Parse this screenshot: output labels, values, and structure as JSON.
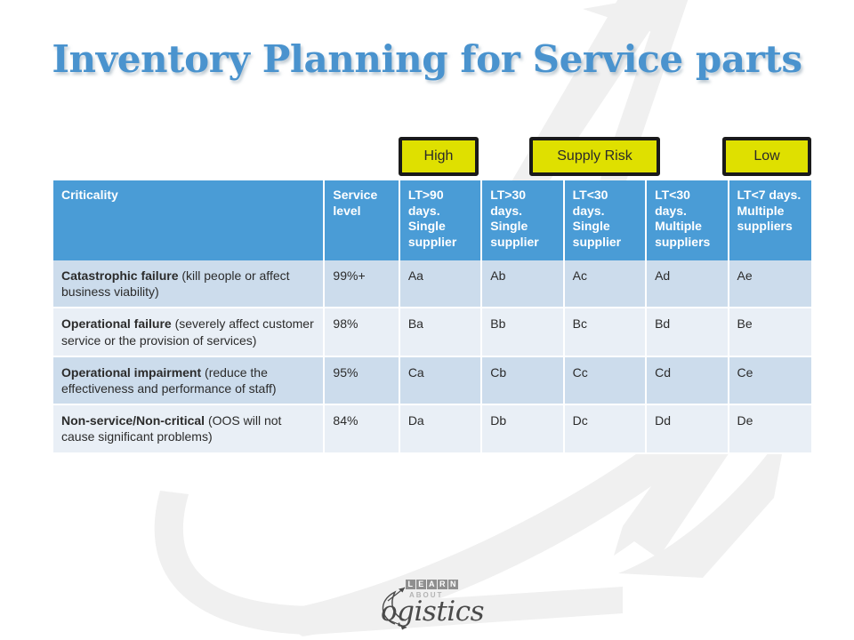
{
  "slide": {
    "title": "Inventory Planning for Service parts",
    "title_color": "#4a93ce",
    "background_color": "#ffffff"
  },
  "legend": {
    "label": "Supply Risk",
    "high": "High",
    "low": "Low",
    "box_fill": "#dfe000",
    "box_border": "#1a1a1a"
  },
  "table": {
    "header_color": "#4a9cd6",
    "row_shade_color": "#ccdcec",
    "row_plain_color": "#e9eff6",
    "columns": [
      "Criticality",
      "Service level",
      "LT>90 days. Single supplier",
      "LT>30 days. Single supplier",
      "LT<30 days. Single supplier",
      "LT<30 days. Multiple suppliers",
      "LT<7 days. Multiple suppliers"
    ],
    "rows": [
      {
        "criticality_name": "Catastrophic failure",
        "criticality_desc": " (kill people or affect business viability)",
        "service_level": "99%+",
        "codes": [
          "Aa",
          "Ab",
          "Ac",
          "Ad",
          "Ae"
        ]
      },
      {
        "criticality_name": "Operational failure",
        "criticality_desc": " (severely affect customer service or the provision of services)",
        "service_level": "98%",
        "codes": [
          "Ba",
          "Bb",
          "Bc",
          "Bd",
          "Be"
        ]
      },
      {
        "criticality_name": "Operational impairment",
        "criticality_desc": " (reduce the effectiveness and performance of staff)",
        "service_level": "95%",
        "codes": [
          "Ca",
          "Cb",
          "Cc",
          "Cd",
          "Ce"
        ]
      },
      {
        "criticality_name": "Non-service/Non-critical",
        "criticality_desc": " (OOS will not cause significant problems)",
        "service_level": "84%",
        "codes": [
          "Da",
          "Db",
          "Dc",
          "Dd",
          "De"
        ]
      }
    ]
  },
  "logo": {
    "learn_letters": [
      "L",
      "E",
      "A",
      "R",
      "N"
    ],
    "about": "ABOUT",
    "script": "ogistics"
  }
}
